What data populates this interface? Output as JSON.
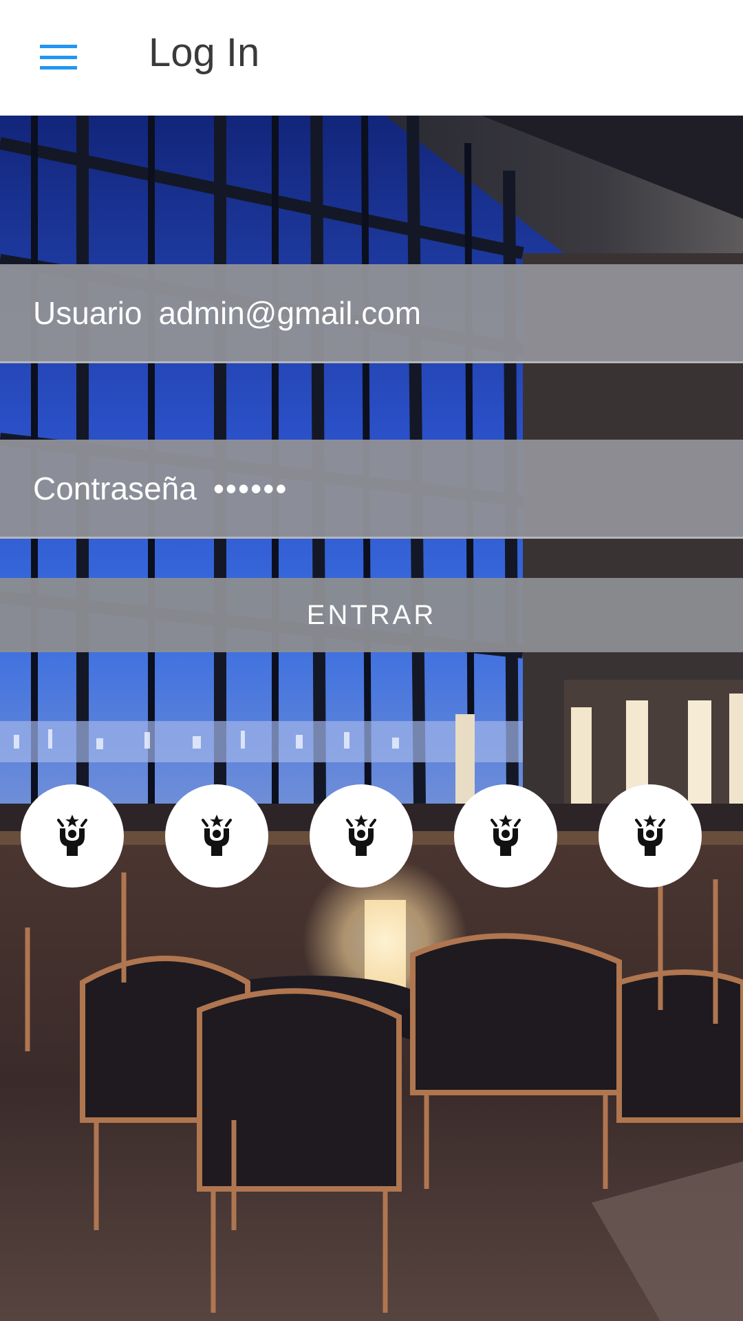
{
  "appbar": {
    "title": "Log In",
    "menu_icon": "hamburger-menu-icon",
    "accent_color": "#2196f3"
  },
  "form": {
    "username": {
      "label": "Usuario",
      "value": "admin@gmail.com"
    },
    "password": {
      "label": "Contraseña",
      "value": "••••••"
    },
    "submit_label": "ENTRAR"
  },
  "icon_buttons": [
    {
      "icon": "cheering-person-icon"
    },
    {
      "icon": "cheering-person-icon"
    },
    {
      "icon": "cheering-person-icon"
    },
    {
      "icon": "cheering-person-icon"
    },
    {
      "icon": "cheering-person-icon"
    }
  ]
}
